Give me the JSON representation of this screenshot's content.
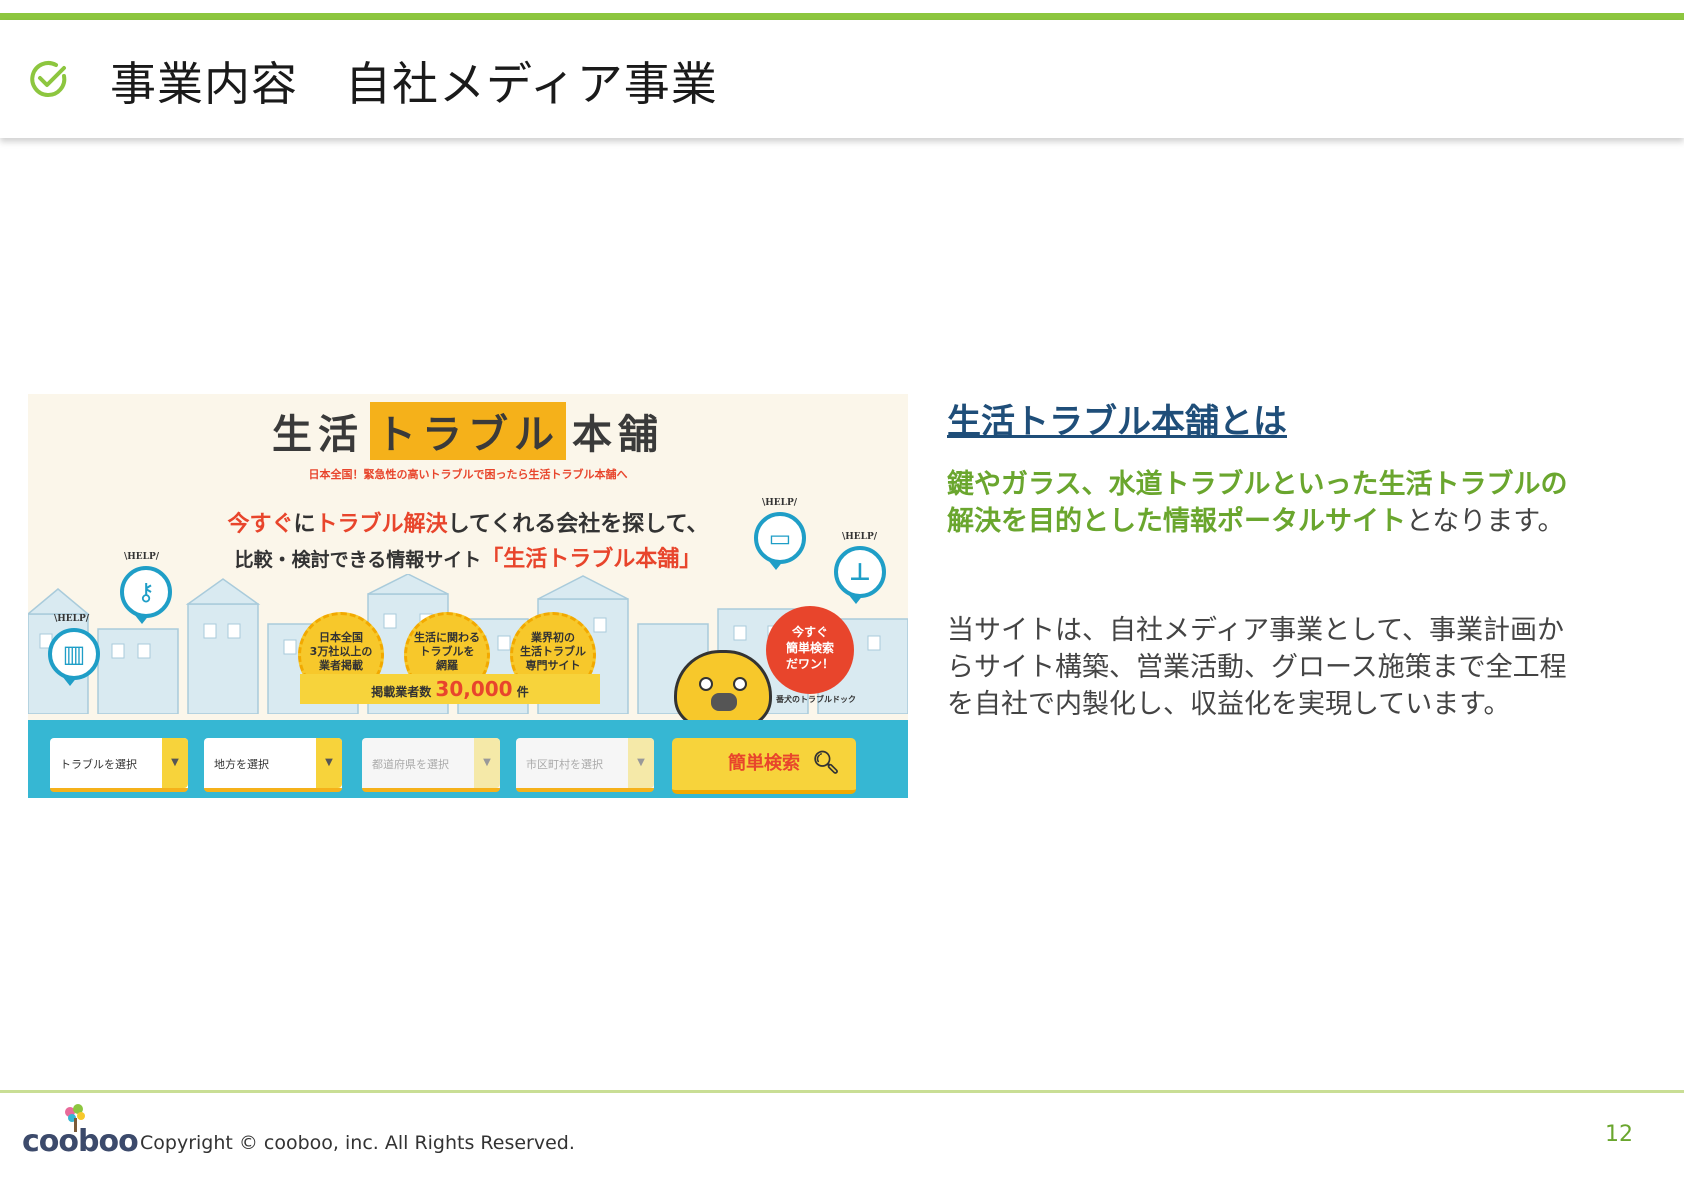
{
  "header": {
    "title": "事業内容　自社メディア事業"
  },
  "screenshot": {
    "logo_parts": [
      "生活",
      "トラブル",
      "本舗"
    ],
    "tagline": "日本全国！緊急性の高いトラブルで困ったら生活トラブル本舗へ",
    "lead1_red1": "今すぐ",
    "lead1_mid1": "に",
    "lead1_red2": "トラブル解決",
    "lead1_rest": "してくれる会社を探して、",
    "lead2_text": "比較・検討できる情報サイト",
    "lead2_red": "「生活トラブル本舗」",
    "help_label": "\\HELP/",
    "medals": [
      {
        "line1": "日本全国",
        "line2": "3万社以上の",
        "line3": "業者掲載"
      },
      {
        "line1": "生活に関わる",
        "line2": "トラブルを",
        "line3": "網羅"
      },
      {
        "line1": "業界初の",
        "line2": "生活トラブル",
        "line3": "専門サイト"
      }
    ],
    "ribbon_label": "掲載業者数",
    "ribbon_number": "30,000",
    "ribbon_unit": "件",
    "promo_line1": "今すぐ",
    "promo_line2": "簡単検索",
    "promo_line3": "だワン！",
    "dog_label": "番犬のトラブルドック",
    "selects": [
      {
        "label": "トラブルを選択"
      },
      {
        "label": "地方を選択"
      },
      {
        "label": "都道府県を選択"
      },
      {
        "label": "市区町村を選択"
      }
    ],
    "search_button": "簡単検索"
  },
  "about": {
    "heading": "生活トラブル本舗とは",
    "desc1_green": "鍵やガラス、水道トラブルといった生活トラブルの解決を目的とした情報ポータルサイト",
    "desc1_rest": "となります。",
    "desc2": "当サイトは、自社メディア事業として、事業計画からサイト構築、営業活動、グロース施策まで全工程を自社で内製化し、収益化を実現しています。"
  },
  "footer": {
    "logo": "cooboo",
    "copyright": "Copyright ©  cooboo, inc. All Rights Reserved.",
    "page_number": "12"
  },
  "colors": {
    "accent_green": "#8dc63f",
    "heading_navy": "#1f4e79",
    "text_green": "#6aa62e",
    "brand_red": "#e8452c",
    "brand_yellow": "#f7d33b",
    "brand_blue": "#36b7d3"
  }
}
